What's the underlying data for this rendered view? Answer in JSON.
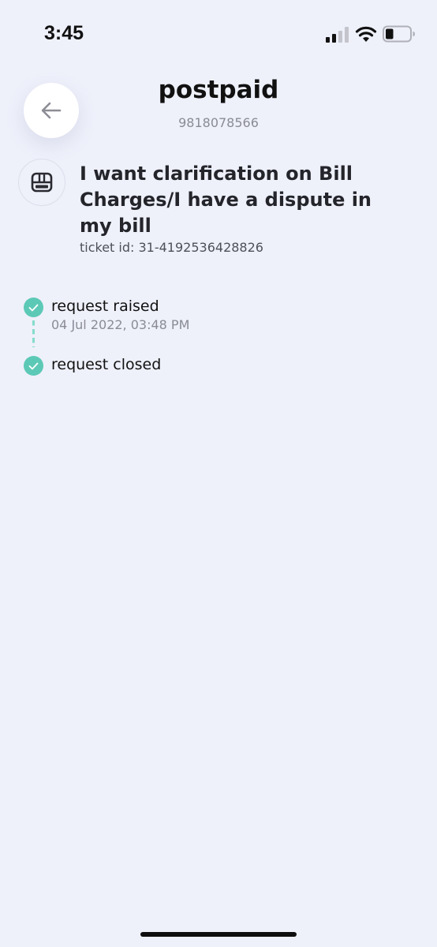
{
  "status_bar": {
    "time": "3:45",
    "icons": [
      "cellular-signal-icon",
      "wifi-icon",
      "battery-icon"
    ],
    "battery_level": 0.3
  },
  "header": {
    "back_icon": "arrow-left-icon",
    "title": "postpaid",
    "subtitle": "9818078566"
  },
  "ticket": {
    "icon": "sim-card-icon",
    "title": "I want clarification on Bill Charges/I have a dispute in my bill",
    "id_text": "ticket id: 31-4192536428826"
  },
  "timeline": {
    "accent_color": "#5cc9b6",
    "steps": [
      {
        "label": "request raised",
        "date": "04 Jul 2022, 03:48 PM",
        "icon": "check-icon"
      },
      {
        "label": "request closed",
        "icon": "check-icon"
      }
    ]
  },
  "colors": {
    "background": "#eef0fa",
    "accent": "#5cc9b6"
  }
}
